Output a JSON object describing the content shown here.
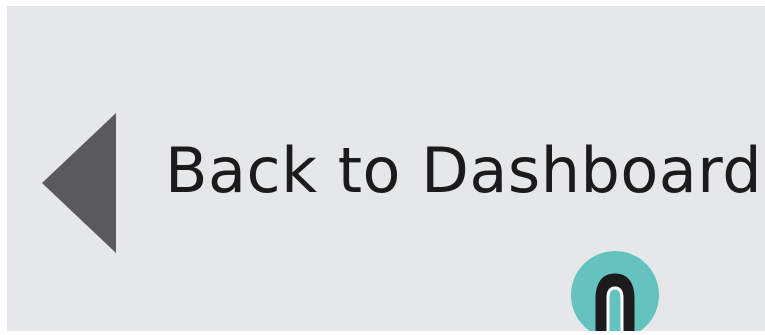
{
  "back_button": {
    "label": "Back to Dashboard",
    "icon": "back-arrow-icon",
    "icon_color": "#5a5a5c"
  },
  "touch_indicator": {
    "icon": "pointer-finger-icon",
    "color": "#65c3bf"
  },
  "colors": {
    "background": "#e6e7e8",
    "text": "#1b1b1b"
  }
}
